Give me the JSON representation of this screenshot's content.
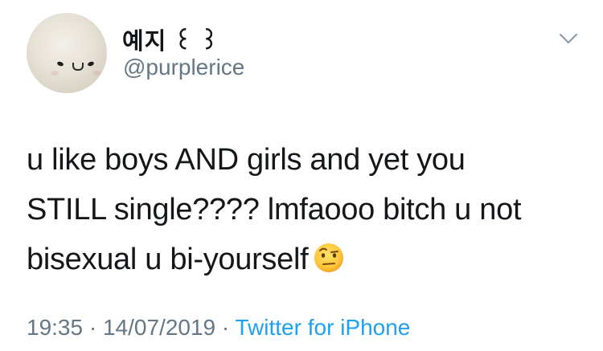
{
  "user": {
    "display_name": "예지 ꒰ ꒱",
    "handle": "@purplerice"
  },
  "tweet": {
    "text": "u like boys AND girls and yet you\nSTILL single???? lmfaooo bitch u not\nbisexual u bi-yourself",
    "emoji": "face-with-raised-eyebrow-emoji"
  },
  "meta": {
    "time": "19:35",
    "separator": " · ",
    "date": "14/07/2019",
    "source": "Twitter for iPhone"
  },
  "icons": {
    "more": "chevron-down-icon"
  },
  "colors": {
    "text": "#14171a",
    "secondary": "#657786",
    "link": "#1da1f2"
  }
}
